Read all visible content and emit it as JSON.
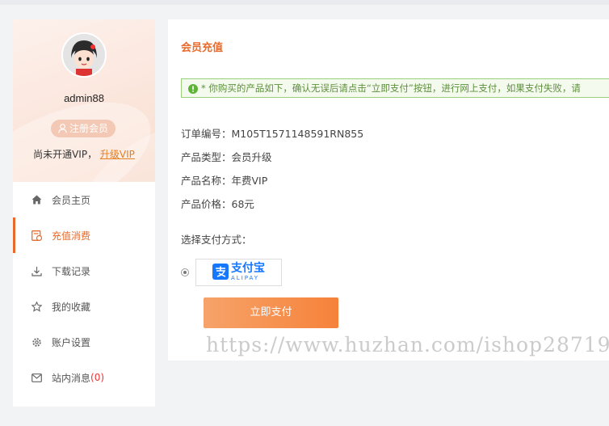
{
  "sidebar": {
    "username": "admin88",
    "member_tag": "注册会员",
    "vip_status": "尚未开通VIP，",
    "upgrade_link": "升级VIP",
    "items": [
      {
        "label": "会员主页",
        "icon": "home-icon"
      },
      {
        "label": "充值消费",
        "icon": "recharge-icon",
        "active": true
      },
      {
        "label": "下载记录",
        "icon": "download-icon"
      },
      {
        "label": "我的收藏",
        "icon": "star-icon"
      },
      {
        "label": "账户设置",
        "icon": "gear-icon"
      },
      {
        "label": "站内消息",
        "icon": "mail-icon",
        "count": "(0)"
      }
    ]
  },
  "main": {
    "title": "会员充值",
    "notice": "* 你购买的产品如下，确认无误后请点击“立即支付”按钮，进行网上支付，如果支付失败，请",
    "order_no": "订单编号：M105T1571148591RN855",
    "product_type": "产品类型：会员升级",
    "product_name": "产品名称：年费VIP",
    "product_price": "产品价格：68元",
    "pay_method_label": "选择支付方式：",
    "alipay": {
      "zh": "支付宝",
      "en": "ALIPAY"
    },
    "pay_button": "立即支付"
  },
  "watermark": "https://www.huzhan.com/ishop28719",
  "colors": {
    "accent": "#e86a2a",
    "notice_green": "#5d8f3c",
    "alipay_blue": "#1677ff"
  }
}
